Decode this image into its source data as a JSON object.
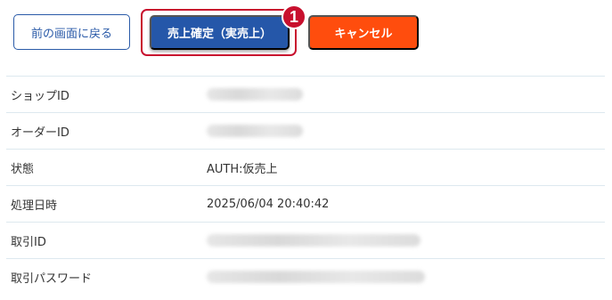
{
  "toolbar": {
    "back_label": "前の画面に戻る",
    "confirm_label": "売上確定（実売上）",
    "cancel_label": "キャンセル",
    "step_badge": "1"
  },
  "details": {
    "shop_id_label": "ショップID",
    "order_id_label": "オーダーID",
    "status_label": "状態",
    "status_value": "AUTH:仮売上",
    "processed_at_label": "処理日時",
    "processed_at_value": "2025/06/04 20:40:42",
    "transaction_id_label": "取引ID",
    "transaction_password_label": "取引パスワード"
  },
  "colors": {
    "primary": "#2557a9",
    "cancel": "#ff4d0d",
    "highlight": "#c8102e"
  }
}
